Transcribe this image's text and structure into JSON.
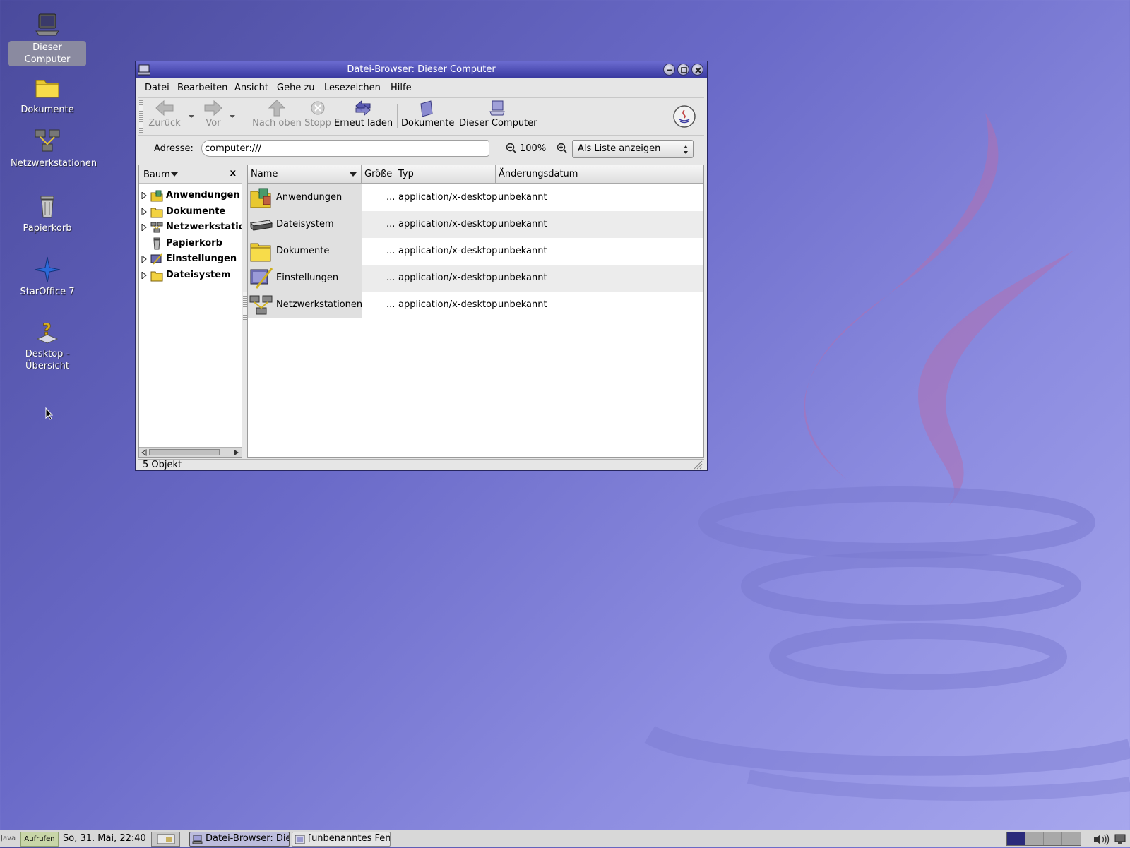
{
  "desktop": {
    "icons": [
      {
        "label": "Dieser Computer",
        "icon": "computer-icon"
      },
      {
        "label": "Dokumente",
        "icon": "folder-icon"
      },
      {
        "label": "Netzwerkstationen",
        "icon": "network-icon"
      },
      {
        "label": "Papierkorb",
        "icon": "trash-icon"
      },
      {
        "label": "StarOffice 7",
        "icon": "staroffice-icon"
      },
      {
        "label": "Desktop - Übersicht",
        "icon": "help-icon"
      }
    ]
  },
  "window": {
    "title": "Datei-Browser: Dieser Computer",
    "menu": [
      "Datei",
      "Bearbeiten",
      "Ansicht",
      "Gehe zu",
      "Lesezeichen",
      "Hilfe"
    ],
    "toolbar": {
      "back": "Zurück",
      "forward": "Vor",
      "up": "Nach oben",
      "stop": "Stopp",
      "reload": "Erneut laden",
      "documents": "Dokumente",
      "computer": "Dieser Computer"
    },
    "location": {
      "label": "Adresse:",
      "value": "computer:///",
      "zoom": "100%",
      "view_mode": "Als Liste anzeigen"
    },
    "sidepane": {
      "title": "Baum",
      "close": "x",
      "items": [
        "Anwendungen",
        "Dokumente",
        "Netzwerkstationen",
        "Papierkorb",
        "Einstellungen",
        "Dateisystem"
      ]
    },
    "columns": [
      "Name",
      "Größe",
      "Typ",
      "Änderungsdatum"
    ],
    "rows": [
      {
        "name": "Anwendungen",
        "size": "...",
        "type": "application/x-desktop",
        "date": "unbekannt"
      },
      {
        "name": "Dateisystem",
        "size": "...",
        "type": "application/x-desktop",
        "date": "unbekannt"
      },
      {
        "name": "Dokumente",
        "size": "...",
        "type": "application/x-desktop",
        "date": "unbekannt"
      },
      {
        "name": "Einstellungen",
        "size": "...",
        "type": "application/x-desktop",
        "date": "unbekannt"
      },
      {
        "name": "Netzwerkstationen",
        "size": "...",
        "type": "application/x-desktop",
        "date": "unbekannt"
      }
    ],
    "status": "5 Objekt"
  },
  "taskbar": {
    "java": "Java",
    "launch": "Aufrufen",
    "clock": "So, 31. Mai, 22:40",
    "windows": [
      "Datei-Browser: Die",
      "[unbenanntes Fen:"
    ]
  },
  "colors": {
    "accent": "#3a3aa0",
    "desktop": "#6a6ac8"
  }
}
